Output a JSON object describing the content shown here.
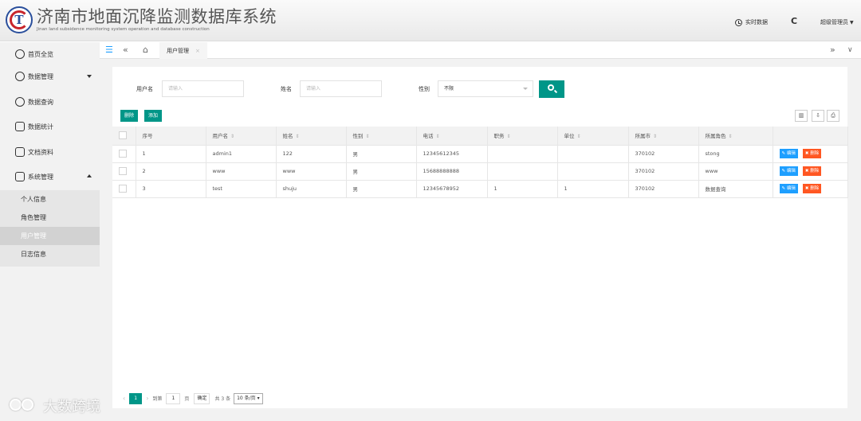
{
  "header": {
    "title": "济南市地面沉降监测数据库系统",
    "subtitle": "Jinan land subsidence monitoring system operation and database construction",
    "realtime_label": "实时数据",
    "refresh_glyph": "C",
    "user_label": "超级管理员"
  },
  "sidebar": {
    "items": [
      {
        "label": "首页全览"
      },
      {
        "label": "数据管理"
      },
      {
        "label": "数据查询"
      },
      {
        "label": "数据统计"
      },
      {
        "label": "文档资料"
      },
      {
        "label": "系统管理"
      }
    ],
    "sub_items": [
      {
        "label": "个人信息"
      },
      {
        "label": "角色管理"
      },
      {
        "label": "用户管理"
      },
      {
        "label": "日志信息"
      }
    ]
  },
  "tabs": {
    "menu_glyph": "☰",
    "prev_glyph": "«",
    "home_glyph": "⌂",
    "active_tab": "用户管理",
    "close_glyph": "×",
    "next_glyph": "»",
    "dropdown_glyph": "∨"
  },
  "search": {
    "username_label": "用户名",
    "username_placeholder": "请输入",
    "name_label": "姓名",
    "name_placeholder": "请输入",
    "gender_label": "性别",
    "gender_value": "不限"
  },
  "toolbar": {
    "delete_label": "删除",
    "add_label": "添加",
    "filter_icon": "▥",
    "export_icon": "⇩",
    "print_icon": "⎙"
  },
  "table": {
    "sort_glyph": "⇕",
    "columns": [
      "序号",
      "用户名",
      "姓名",
      "性别",
      "电话",
      "职务",
      "单位",
      "所属市",
      "所属角色"
    ],
    "rows": [
      {
        "cells": [
          "1",
          "admin1",
          "122",
          "男",
          "12345612345",
          "",
          "",
          "370102",
          "stong"
        ]
      },
      {
        "cells": [
          "2",
          "www",
          "www",
          "男",
          "15688888888",
          "",
          "",
          "370102",
          "www"
        ]
      },
      {
        "cells": [
          "3",
          "test",
          "shuju",
          "男",
          "12345678952",
          "1",
          "1",
          "370102",
          "数据查询"
        ]
      }
    ],
    "edit_label": "✎ 编辑",
    "delete_label": "✖ 删除"
  },
  "pager": {
    "current_page": "1",
    "goto_label": "到第",
    "goto_value": "1",
    "page_unit": "页",
    "confirm_label": "确定",
    "total_label": "共 3 条",
    "page_size": "10 条/页 ▾"
  },
  "watermark": {
    "text": "大数跨境"
  }
}
